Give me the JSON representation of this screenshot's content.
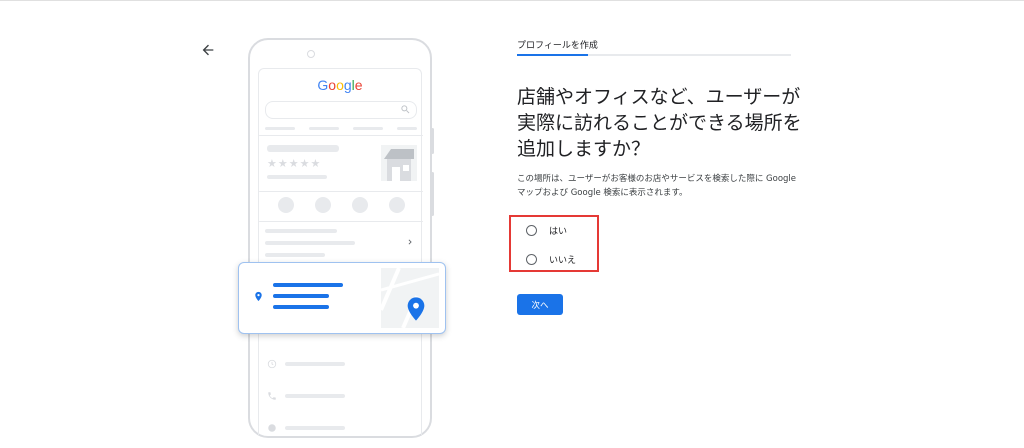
{
  "illustration": {
    "logo_text": "Google"
  },
  "form": {
    "step_label": "プロフィールを作成",
    "progress_fraction": 0.26,
    "question": "店舗やオフィスなど、ユーザーが実際に訪れることができる場所を追加しますか？",
    "description": "この場所は、ユーザーがお客様のお店やサービスを検索した際に Google マップおよび Google 検索に表示されます。",
    "options": [
      {
        "label": "はい",
        "selected": false
      },
      {
        "label": "いいえ",
        "selected": false
      }
    ],
    "next_label": "次へ"
  },
  "colors": {
    "accent": "#1a73e8",
    "highlight": "#e53935"
  },
  "icons": [
    "arrow-back-icon",
    "search-icon",
    "phone-icon",
    "directions-icon",
    "bookmark-icon",
    "globe-icon",
    "chevron-right-icon",
    "location-pin-icon",
    "clock-icon"
  ]
}
